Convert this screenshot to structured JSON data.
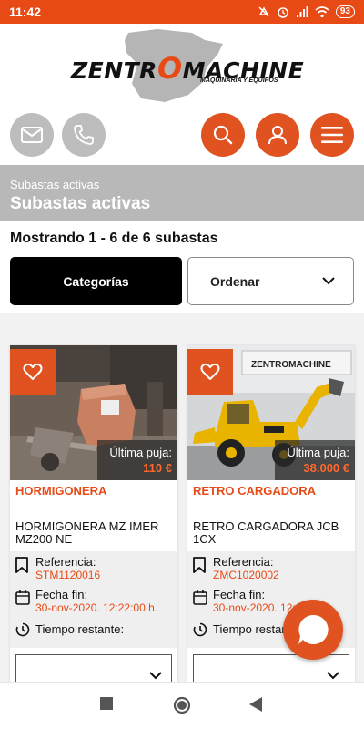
{
  "status_bar": {
    "time": "11:42",
    "battery": "93",
    "icons": [
      "mute-icon",
      "alarm-icon",
      "signal-icon",
      "wifi-icon",
      "battery-icon"
    ]
  },
  "logo": {
    "text_left": "ZENTR",
    "text_o": "O",
    "text_right": "MACHINE",
    "tagline": "MAQUINARIA Y EQUIPOS"
  },
  "actions": {
    "left": [
      "mail-icon",
      "phone-icon"
    ],
    "right": [
      "search-icon",
      "user-icon",
      "menu-icon"
    ]
  },
  "header": {
    "breadcrumb": "Subastas activas",
    "title": "Subastas activas"
  },
  "results": {
    "count_text": "Mostrando 1 - 6 de 6 subastas"
  },
  "filters": {
    "categories_label": "Categorías",
    "sort_label": "Ordenar"
  },
  "cards": [
    {
      "category": "HORMIGONERA",
      "title": "HORMIGONERA MZ IMER MZ200 NE",
      "bid_label": "Última puja:",
      "bid_value": "110 €",
      "ref_label": "Referencia:",
      "ref_value": "STM1120016",
      "end_label": "Fecha fin:",
      "end_value": "30-nov-2020. 12:22:00 h.",
      "remaining_label": "Tiempo restante:"
    },
    {
      "category": "RETRO CARGADORA",
      "title": "RETRO CARGADORA JCB 1CX",
      "bid_label": "Última puja:",
      "bid_value": "38.000 €",
      "ref_label": "Referencia:",
      "ref_value": "ZMC1020002",
      "end_label": "Fecha fin:",
      "end_value": "30-nov-2020. 12:22:00 h.",
      "remaining_label": "Tiempo restante:",
      "photo_sign": "ZENTROMACHINE"
    }
  ],
  "colors": {
    "accent": "#e84a16",
    "button_orange": "#e0521f",
    "button_grey": "#bdbdbd",
    "header_grey": "#b8b8b8"
  }
}
